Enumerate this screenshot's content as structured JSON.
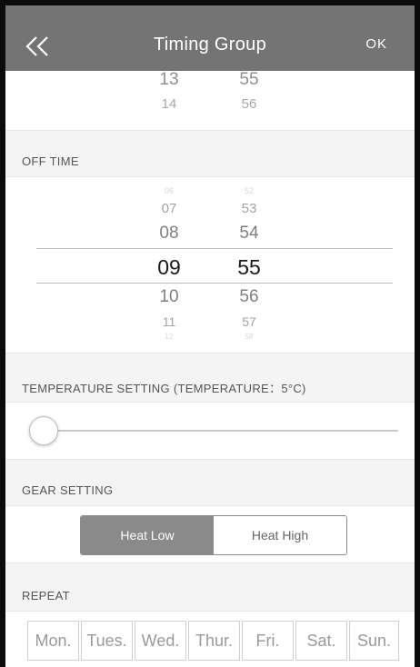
{
  "header": {
    "back_icon": "double-chevron-left-icon",
    "title": "Timing Group",
    "ok_label": "OK",
    "background": "#747474"
  },
  "top_picker": {
    "hours": [
      "13",
      "14"
    ],
    "minutes": [
      "55",
      "56"
    ]
  },
  "off_time": {
    "label": "OFF TIME",
    "hours": [
      "06",
      "07",
      "08",
      "09",
      "10",
      "11",
      "12"
    ],
    "minutes": [
      "52",
      "53",
      "54",
      "55",
      "56",
      "57",
      "58"
    ],
    "selected_hour": "09",
    "selected_minute": "55"
  },
  "temperature": {
    "label": "TEMPERATURE SETTING (TEMPERATURE：5°C)",
    "slider_value_fraction": 0.0
  },
  "gear": {
    "label": "GEAR SETTING",
    "options": [
      "Heat Low",
      "Heat High"
    ],
    "selected": "Heat Low",
    "accent": "#8a8a8a"
  },
  "repeat": {
    "label": "REPEAT",
    "days": [
      "Mon.",
      "Tues.",
      "Wed.",
      "Thur.",
      "Fri.",
      "Sat.",
      "Sun."
    ]
  }
}
